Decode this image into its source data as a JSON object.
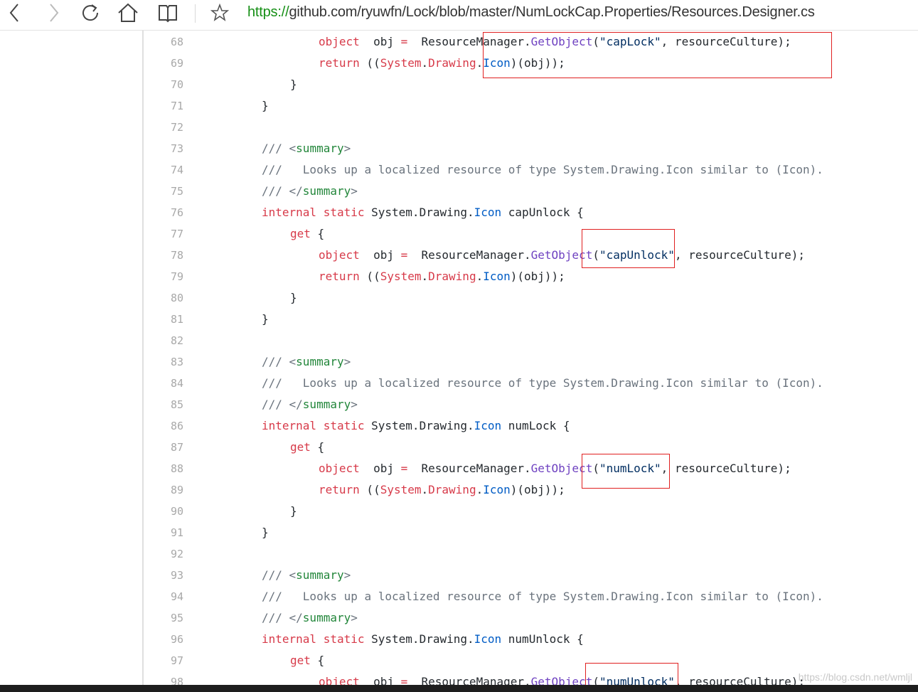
{
  "browser": {
    "url_scheme": "https://",
    "url_rest": "github.com/ryuwfn/Lock/blob/master/NumLockCap.Properties/Resources.Designer.cs",
    "icons": [
      "back-icon",
      "forward-icon",
      "refresh-icon",
      "home-icon",
      "reading-view-icon",
      "favorite-star-icon"
    ]
  },
  "code": {
    "lines": [
      {
        "n": "68",
        "tokens": [
          [
            "k",
            "object"
          ],
          [
            "",
            "  obj "
          ],
          [
            "k",
            "="
          ],
          [
            "",
            "  ResourceManager."
          ],
          [
            "f",
            "GetObject"
          ],
          [
            "",
            "("
          ],
          [
            "s",
            "\"capLock\""
          ],
          [
            "",
            ", resourceCulture);"
          ]
        ]
      },
      {
        "n": "69",
        "tokens": [
          [
            "k",
            "return"
          ],
          [
            "",
            " (("
          ],
          [
            "k",
            "System"
          ],
          [
            "",
            "."
          ],
          [
            "k",
            "Drawing"
          ],
          [
            "",
            "."
          ],
          [
            "t",
            "Icon"
          ],
          [
            "",
            ")(obj));"
          ]
        ]
      },
      {
        "n": "70",
        "tokens": [
          [
            "",
            "}"
          ]
        ]
      },
      {
        "n": "71",
        "tokens": [
          [
            "",
            "}"
          ]
        ]
      },
      {
        "n": "72",
        "tokens": []
      },
      {
        "n": "73",
        "tokens": [
          [
            "c",
            "/// <"
          ],
          [
            "g",
            "summary"
          ],
          [
            "c",
            ">"
          ]
        ]
      },
      {
        "n": "74",
        "tokens": [
          [
            "c",
            "///   Looks up a localized resource of type System.Drawing.Icon similar to (Icon)."
          ]
        ]
      },
      {
        "n": "75",
        "tokens": [
          [
            "c",
            "/// </"
          ],
          [
            "g",
            "summary"
          ],
          [
            "c",
            ">"
          ]
        ]
      },
      {
        "n": "76",
        "tokens": [
          [
            "k",
            "internal"
          ],
          [
            "",
            " "
          ],
          [
            "k",
            "static"
          ],
          [
            "",
            " System.Drawing."
          ],
          [
            "t",
            "Icon"
          ],
          [
            "",
            " capUnlock {"
          ]
        ]
      },
      {
        "n": "77",
        "tokens": [
          [
            "k",
            "get"
          ],
          [
            "",
            " {"
          ]
        ]
      },
      {
        "n": "78",
        "tokens": [
          [
            "k",
            "object"
          ],
          [
            "",
            "  obj "
          ],
          [
            "k",
            "="
          ],
          [
            "",
            "  ResourceManager."
          ],
          [
            "f",
            "GetObject"
          ],
          [
            "",
            "("
          ],
          [
            "s",
            "\"capUnlock\""
          ],
          [
            "",
            ", resourceCulture);"
          ]
        ]
      },
      {
        "n": "79",
        "tokens": [
          [
            "k",
            "return"
          ],
          [
            "",
            " (("
          ],
          [
            "k",
            "System"
          ],
          [
            "",
            "."
          ],
          [
            "k",
            "Drawing"
          ],
          [
            "",
            "."
          ],
          [
            "t",
            "Icon"
          ],
          [
            "",
            ")(obj));"
          ]
        ]
      },
      {
        "n": "80",
        "tokens": [
          [
            "",
            "}"
          ]
        ]
      },
      {
        "n": "81",
        "tokens": [
          [
            "",
            "}"
          ]
        ]
      },
      {
        "n": "82",
        "tokens": []
      },
      {
        "n": "83",
        "tokens": [
          [
            "c",
            "/// <"
          ],
          [
            "g",
            "summary"
          ],
          [
            "c",
            ">"
          ]
        ]
      },
      {
        "n": "84",
        "tokens": [
          [
            "c",
            "///   Looks up a localized resource of type System.Drawing.Icon similar to (Icon)."
          ]
        ]
      },
      {
        "n": "85",
        "tokens": [
          [
            "c",
            "/// </"
          ],
          [
            "g",
            "summary"
          ],
          [
            "c",
            ">"
          ]
        ]
      },
      {
        "n": "86",
        "tokens": [
          [
            "k",
            "internal"
          ],
          [
            "",
            " "
          ],
          [
            "k",
            "static"
          ],
          [
            "",
            " System.Drawing."
          ],
          [
            "t",
            "Icon"
          ],
          [
            "",
            " numLock {"
          ]
        ]
      },
      {
        "n": "87",
        "tokens": [
          [
            "k",
            "get"
          ],
          [
            "",
            " {"
          ]
        ]
      },
      {
        "n": "88",
        "tokens": [
          [
            "k",
            "object"
          ],
          [
            "",
            "  obj "
          ],
          [
            "k",
            "="
          ],
          [
            "",
            "  ResourceManager."
          ],
          [
            "f",
            "GetObject"
          ],
          [
            "",
            "("
          ],
          [
            "s",
            "\"numLock\""
          ],
          [
            "",
            ", resourceCulture);"
          ]
        ]
      },
      {
        "n": "89",
        "tokens": [
          [
            "k",
            "return"
          ],
          [
            "",
            " (("
          ],
          [
            "k",
            "System"
          ],
          [
            "",
            "."
          ],
          [
            "k",
            "Drawing"
          ],
          [
            "",
            "."
          ],
          [
            "t",
            "Icon"
          ],
          [
            "",
            ")(obj));"
          ]
        ]
      },
      {
        "n": "90",
        "tokens": [
          [
            "",
            "}"
          ]
        ]
      },
      {
        "n": "91",
        "tokens": [
          [
            "",
            "}"
          ]
        ]
      },
      {
        "n": "92",
        "tokens": []
      },
      {
        "n": "93",
        "tokens": [
          [
            "c",
            "/// <"
          ],
          [
            "g",
            "summary"
          ],
          [
            "c",
            ">"
          ]
        ]
      },
      {
        "n": "94",
        "tokens": [
          [
            "c",
            "///   Looks up a localized resource of type System.Drawing.Icon similar to (Icon)."
          ]
        ]
      },
      {
        "n": "95",
        "tokens": [
          [
            "c",
            "/// </"
          ],
          [
            "g",
            "summary"
          ],
          [
            "c",
            ">"
          ]
        ]
      },
      {
        "n": "96",
        "tokens": [
          [
            "k",
            "internal"
          ],
          [
            "",
            " "
          ],
          [
            "k",
            "static"
          ],
          [
            "",
            " System.Drawing."
          ],
          [
            "t",
            "Icon"
          ],
          [
            "",
            " numUnlock {"
          ]
        ]
      },
      {
        "n": "97",
        "tokens": [
          [
            "k",
            "get"
          ],
          [
            "",
            " {"
          ]
        ]
      },
      {
        "n": "98",
        "tokens": [
          [
            "k",
            "object"
          ],
          [
            "",
            "  obj "
          ],
          [
            "k",
            "="
          ],
          [
            "",
            "  ResourceManager."
          ],
          [
            "f",
            "GetObject"
          ],
          [
            "",
            "("
          ],
          [
            "s",
            "\"numUnlock\""
          ],
          [
            "",
            ", resourceCulture);"
          ]
        ]
      }
    ]
  },
  "watermark": "https://blog.csdn.net/wmljl",
  "colors": {
    "keyword": "#d73a49",
    "function": "#6f42c1",
    "type": "#005cc5",
    "string": "#032f62",
    "tag": "#22863a",
    "comment": "#6a737d",
    "highlight_box": "#e02020",
    "url_scheme": "#168f16"
  }
}
